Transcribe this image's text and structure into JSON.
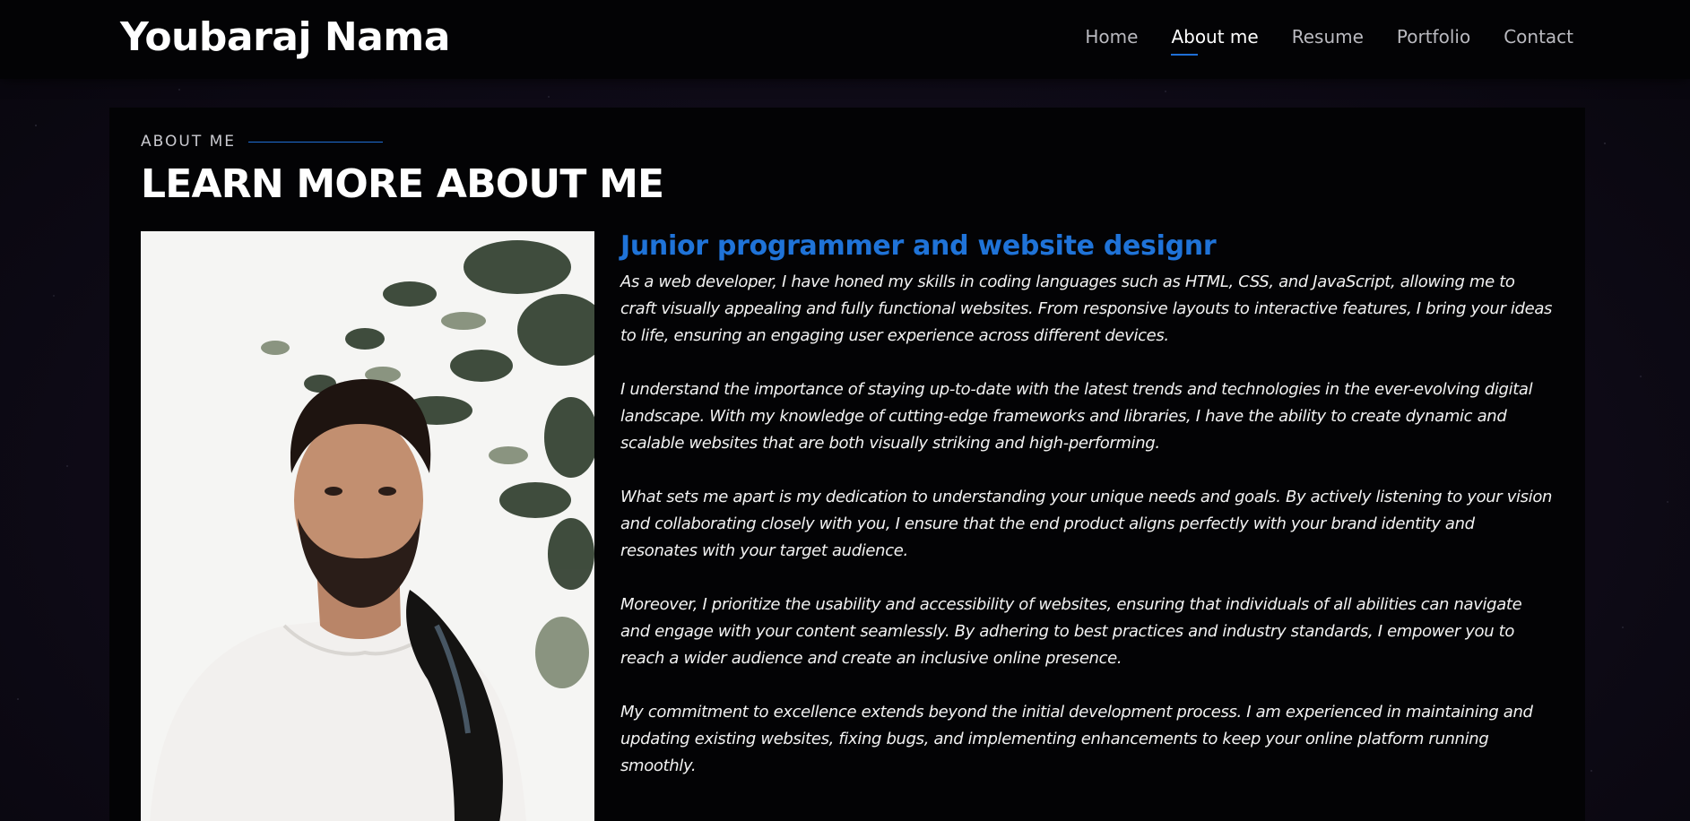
{
  "header": {
    "logo": "Youbaraj Nama",
    "nav": [
      {
        "label": "Home",
        "active": false
      },
      {
        "label": "About me",
        "active": true
      },
      {
        "label": "Resume",
        "active": false
      },
      {
        "label": "Portfolio",
        "active": false
      },
      {
        "label": "Contact",
        "active": false
      }
    ]
  },
  "about": {
    "section_label": "ABOUT ME",
    "title": "LEARN MORE ABOUT ME",
    "role_title": "Junior programmer and website designr",
    "paragraphs": [
      "As a web developer, I have honed my skills in coding languages such as HTML, CSS, and JavaScript, allowing me to craft visually appealing and fully functional websites. From responsive layouts to interactive features, I bring your ideas to life, ensuring an engaging user experience across different devices.",
      "I understand the importance of staying up-to-date with the latest trends and technologies in the ever-evolving digital landscape. With my knowledge of cutting-edge frameworks and libraries, I have the ability to create dynamic and scalable websites that are both visually striking and high-performing.",
      "What sets me apart is my dedication to understanding your unique needs and goals. By actively listening to your vision and collaborating closely with you, I ensure that the end product aligns perfectly with your brand identity and resonates with your target audience.",
      "Moreover, I prioritize the usability and accessibility of websites, ensuring that individuals of all abilities can navigate and engage with your content seamlessly. By adhering to best practices and industry standards, I empower you to reach a wider audience and create an inclusive online presence.",
      "My commitment to excellence extends beyond the initial development process. I am experienced in maintaining and updating existing websites, fixing bugs, and implementing enhancements to keep your online platform running smoothly."
    ]
  },
  "colors": {
    "accent": "#1f73d8",
    "background": "#0f0b18",
    "navbar": "#030305",
    "panel": "#030305",
    "text": "#f2f2f2"
  }
}
